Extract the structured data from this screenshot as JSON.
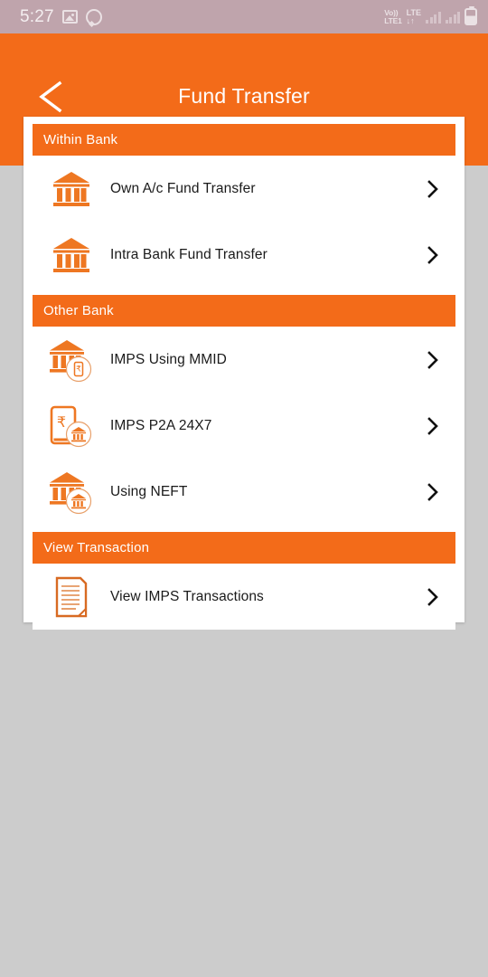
{
  "status_bar": {
    "time": "5:27",
    "icons_left": [
      "gallery-icon",
      "whatsapp-icon"
    ],
    "volte_line1": "Vo))",
    "volte_line2": "LTE1",
    "lte_line1": "LTE",
    "lte_line2": "↓↑",
    "icons_right": [
      "signal-bars-icon",
      "signal-bars-icon",
      "battery-icon"
    ],
    "background_color": "#bfa4ac"
  },
  "header": {
    "title": "Fund Transfer",
    "back_icon": "chevron-left-icon",
    "background_color": "#f36b19",
    "text_color": "#ffffff"
  },
  "theme": {
    "accent": "#f36b19",
    "page_background": "#cccccc",
    "card_background": "#ffffff",
    "label_color": "#1a1a1a"
  },
  "sections": [
    {
      "title": "Within Bank",
      "rows": [
        {
          "label": "Own A/c Fund Transfer",
          "icon": "bank-icon",
          "chevron": "chevron-right-icon"
        },
        {
          "label": "Intra Bank Fund Transfer",
          "icon": "bank-icon",
          "chevron": "chevron-right-icon"
        }
      ]
    },
    {
      "title": "Other Bank",
      "rows": [
        {
          "label": "IMPS Using MMID",
          "icon": "bank-with-mobile-rupee-badge-icon",
          "chevron": "chevron-right-icon"
        },
        {
          "label": "IMPS P2A 24X7",
          "icon": "mobile-rupee-with-bank-badge-icon",
          "chevron": "chevron-right-icon"
        },
        {
          "label": "Using NEFT",
          "icon": "bank-with-bank-badge-icon",
          "chevron": "chevron-right-icon"
        }
      ]
    },
    {
      "title": "View Transaction",
      "rows": [
        {
          "label": "View IMPS Transactions",
          "icon": "document-lines-icon",
          "chevron": "chevron-right-icon"
        }
      ]
    }
  ]
}
